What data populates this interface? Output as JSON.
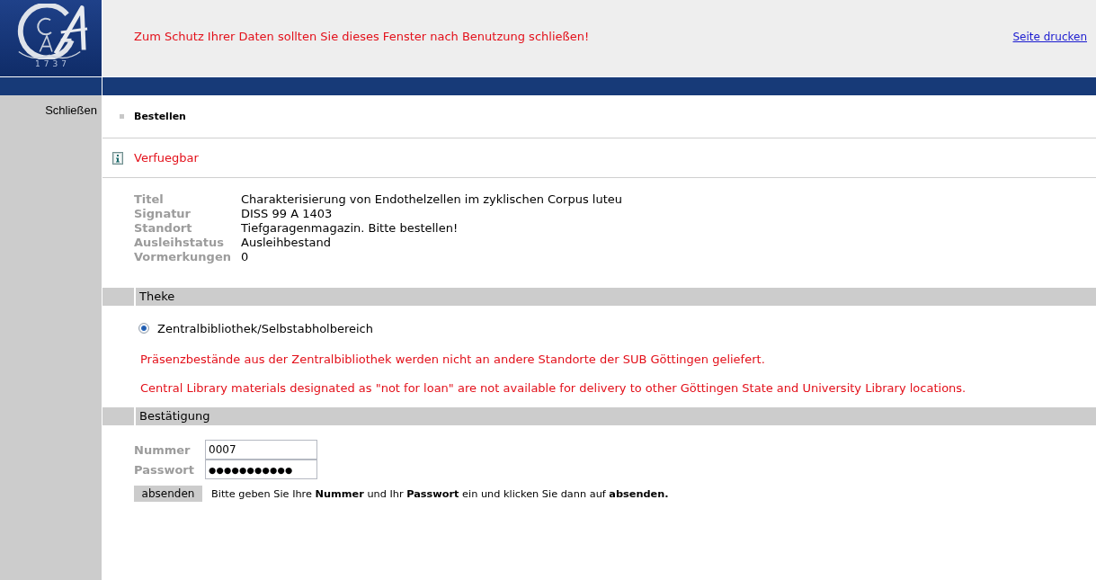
{
  "header": {
    "logo_year": "1737",
    "notice": "Zum Schutz Ihrer Daten sollten Sie dieses Fenster nach Benutzung schließen!",
    "print_link": "Seite drucken"
  },
  "sidebar": {
    "close_link": "Schließen"
  },
  "section": {
    "title": "Bestellen"
  },
  "availability": {
    "text": "Verfuegbar"
  },
  "details": [
    {
      "label": "Titel",
      "value": "Charakterisierung von Endothelzellen im zyklischen Corpus luteu"
    },
    {
      "label": "Signatur",
      "value": "DISS 99 A 1403"
    },
    {
      "label": "Standort",
      "value": "Tiefgaragenmagazin. Bitte bestellen!"
    },
    {
      "label": "Ausleihstatus",
      "value": "Ausleihbestand"
    },
    {
      "label": "Vormerkungen",
      "value": "0"
    }
  ],
  "counter": {
    "title": "Theke",
    "options": [
      {
        "label": "Zentralbibliothek/Selbstabholbereich",
        "selected": true
      }
    ],
    "notes": [
      "Präsenzbestände aus der Zentralbibliothek werden nicht an andere Standorte der SUB Göttingen geliefert.",
      "Central Library materials designated as \"not for loan\" are not available for delivery to other Göttingen State and University Library locations."
    ]
  },
  "confirmation": {
    "title": "Bestätigung",
    "fields": [
      {
        "label": "Nummer",
        "value": "0007",
        "kind": "text"
      },
      {
        "label": "Passwort",
        "value": "●●●●●●●●●●●",
        "kind": "password"
      }
    ],
    "submit": "absenden",
    "hint": "Bitte geben Sie Ihre **Nummer** und Ihr **Passwort** ein und klicken Sie dann auf **absenden.**"
  }
}
